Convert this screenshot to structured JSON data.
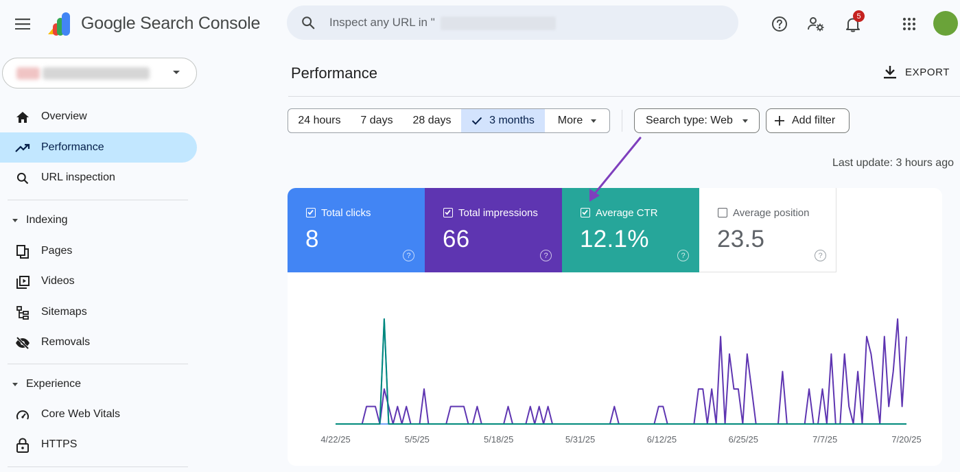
{
  "app": {
    "title": "Google Search Console"
  },
  "search": {
    "placeholder": "Inspect any URL in \""
  },
  "notifications": {
    "count": "5"
  },
  "sidebar": {
    "items": [
      {
        "label": "Overview",
        "icon": "home-icon"
      },
      {
        "label": "Performance",
        "icon": "trending-up-icon",
        "active": true
      },
      {
        "label": "URL inspection",
        "icon": "search-icon"
      }
    ],
    "indexing": {
      "label": "Indexing",
      "items": [
        {
          "label": "Pages",
          "icon": "pages-icon"
        },
        {
          "label": "Videos",
          "icon": "video-icon"
        },
        {
          "label": "Sitemaps",
          "icon": "sitemap-icon"
        },
        {
          "label": "Removals",
          "icon": "eye-off-icon"
        }
      ]
    },
    "experience": {
      "label": "Experience",
      "items": [
        {
          "label": "Core Web Vitals",
          "icon": "gauge-icon"
        },
        {
          "label": "HTTPS",
          "icon": "lock-icon"
        }
      ]
    }
  },
  "main": {
    "title": "Performance",
    "export_label": "EXPORT",
    "date_ranges": [
      "24 hours",
      "7 days",
      "28 days",
      "3 months",
      "More"
    ],
    "selected_range": "3 months",
    "search_type": "Search type: Web",
    "add_filter": "Add filter",
    "last_update": "Last update: 3 hours ago"
  },
  "metrics": [
    {
      "label": "Total clicks",
      "value": "8",
      "checked": true,
      "color": "#4285f4"
    },
    {
      "label": "Total impressions",
      "value": "66",
      "checked": true,
      "color": "#5e35b1"
    },
    {
      "label": "Average CTR",
      "value": "12.1%",
      "checked": true,
      "color": "#26a69a"
    },
    {
      "label": "Average position",
      "value": "23.5",
      "checked": false,
      "color": "#ffffff"
    }
  ],
  "chart_data": {
    "type": "line",
    "x_tick_labels": [
      "4/22/25",
      "5/5/25",
      "5/18/25",
      "5/31/25",
      "6/12/25",
      "6/25/25",
      "7/7/25",
      "7/20/25"
    ],
    "series": [
      {
        "name": "Total impressions",
        "color": "#5e35b1",
        "values": [
          0,
          0,
          0,
          0,
          0,
          0,
          0,
          1,
          1,
          1,
          0,
          2,
          1,
          0,
          1,
          0,
          1,
          0,
          0,
          0,
          2,
          0,
          0,
          0,
          0,
          0,
          1,
          1,
          1,
          1,
          0,
          0,
          1,
          0,
          0,
          0,
          0,
          0,
          0,
          1,
          0,
          0,
          0,
          0,
          1,
          0,
          1,
          0,
          1,
          0,
          0,
          0,
          0,
          0,
          0,
          0,
          0,
          0,
          0,
          0,
          0,
          0,
          0,
          1,
          0,
          0,
          0,
          0,
          0,
          0,
          0,
          0,
          0,
          1,
          1,
          0,
          0,
          0,
          0,
          0,
          0,
          0,
          2,
          2,
          0,
          2,
          0,
          5,
          0,
          4,
          2,
          2,
          0,
          4,
          2,
          0,
          0,
          0,
          0,
          0,
          0,
          3,
          0,
          0,
          0,
          0,
          0,
          2,
          0,
          0,
          2,
          0,
          4,
          0,
          0,
          4,
          1,
          0,
          3,
          0,
          5,
          4,
          2,
          0,
          5,
          1,
          3,
          6,
          1,
          5
        ]
      },
      {
        "name": "Total clicks",
        "color": "#4285f4",
        "values": [
          0,
          0,
          0,
          0,
          0,
          0,
          0,
          0,
          0,
          0,
          0,
          1,
          0,
          0,
          0,
          0,
          0,
          0,
          0,
          0,
          0,
          0,
          0,
          0,
          0,
          0,
          0,
          0,
          0,
          0,
          0,
          0,
          0,
          0,
          0,
          0,
          0,
          0,
          0,
          0,
          0,
          0,
          0,
          0,
          0,
          0,
          0,
          0,
          0,
          0,
          0,
          0,
          0,
          0,
          0,
          0,
          0,
          0,
          0,
          0,
          0,
          0,
          0,
          0,
          0,
          0,
          0,
          0,
          0,
          0,
          0,
          0,
          0,
          0,
          0,
          0,
          0,
          0,
          0,
          0,
          0,
          0,
          0,
          0,
          0,
          0,
          0,
          0,
          0,
          0,
          0,
          0,
          0,
          0,
          0,
          0,
          0,
          0,
          0,
          0,
          0,
          0,
          0,
          0,
          0,
          0,
          0,
          0,
          0,
          0,
          0,
          0,
          0,
          0,
          0,
          0,
          0,
          0,
          0,
          0,
          0,
          0,
          0,
          0,
          0,
          0,
          0,
          0,
          0,
          0
        ]
      },
      {
        "name": "Average CTR",
        "color": "#00897b",
        "values": [
          0,
          0,
          0,
          0,
          0,
          0,
          0,
          0,
          0,
          0,
          0,
          100,
          0,
          0,
          0,
          0,
          0,
          0,
          0,
          0,
          0,
          0,
          0,
          0,
          0,
          0,
          0,
          0,
          0,
          0,
          0,
          0,
          0,
          0,
          0,
          0,
          0,
          0,
          0,
          0,
          0,
          0,
          0,
          0,
          0,
          0,
          0,
          0,
          0,
          0,
          0,
          0,
          0,
          0,
          0,
          0,
          0,
          0,
          0,
          0,
          0,
          0,
          0,
          0,
          0,
          0,
          0,
          0,
          0,
          0,
          0,
          0,
          0,
          0,
          0,
          0,
          0,
          0,
          0,
          0,
          0,
          0,
          0,
          0,
          0,
          0,
          0,
          0,
          0,
          0,
          0,
          0,
          0,
          0,
          0,
          0,
          0,
          0,
          0,
          0,
          0,
          0,
          0,
          0,
          0,
          0,
          0,
          0,
          0,
          0,
          0,
          0,
          0,
          0,
          0,
          0,
          0,
          0,
          0,
          0,
          0,
          0,
          0,
          0,
          0,
          0,
          0,
          0,
          0,
          0
        ]
      }
    ]
  }
}
